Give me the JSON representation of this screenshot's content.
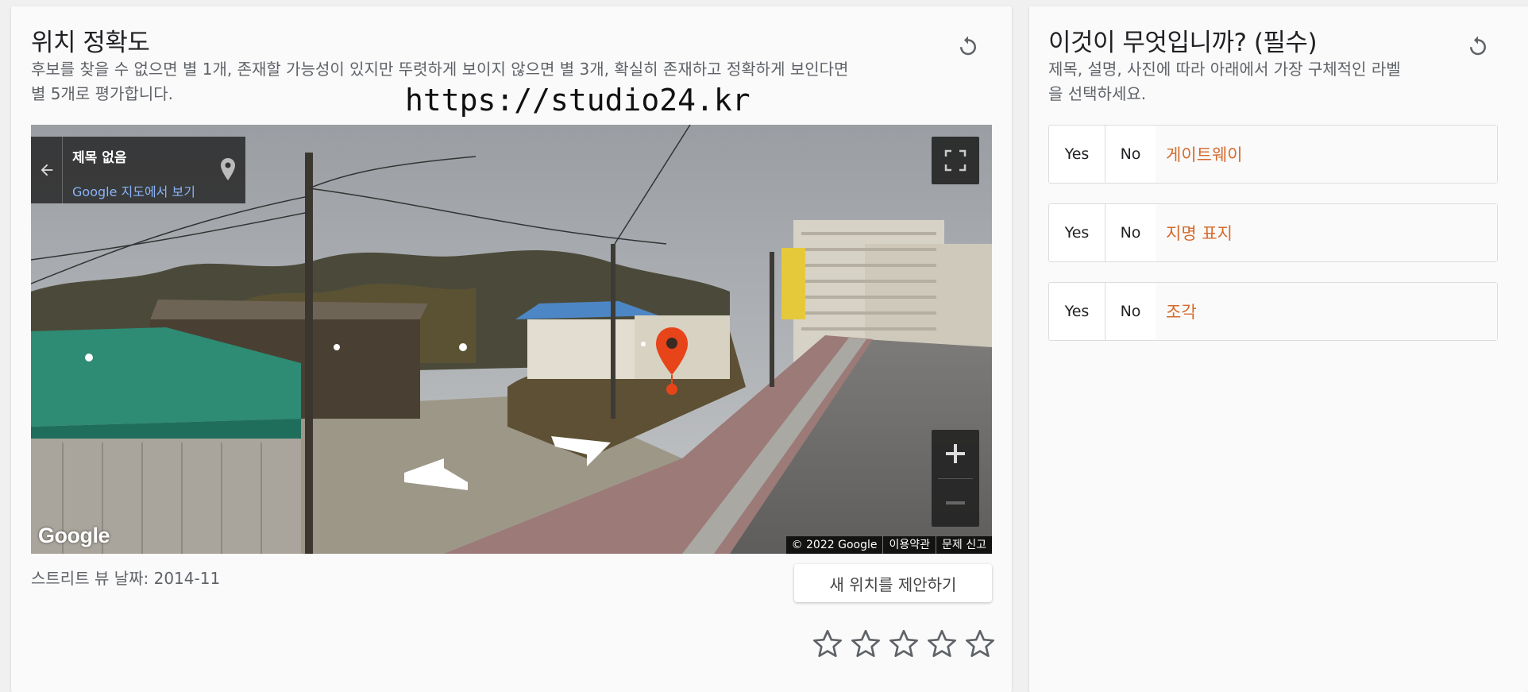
{
  "left": {
    "title": "위치 정확도",
    "description_line1": "후보를 찾을 수 없으면 별 1개, 존재할 가능성이 있지만 뚜렷하게 보이지 않으면 별 3개, 확실히 존재하고 정확하게 보인다면",
    "description_line2": "별 5개로 평가합니다.",
    "watermark": "https://studio24.kr",
    "streetview": {
      "place_title": "제목 없음",
      "maps_link": "Google 지도에서 보기",
      "logo": "Google",
      "copyright": "© 2022 Google",
      "terms": "이용약관",
      "report": "문제 신고"
    },
    "date_label": "스트리트 뷰 날짜: 2014-11",
    "suggest_button": "새 위치를 제안하기",
    "rating": {
      "max": 5,
      "value": 0
    }
  },
  "right": {
    "title": "이것이 무엇입니까? (필수)",
    "description_line1": "제목, 설명, 사진에 따라 아래에서 가장 구체적인 라벨",
    "description_line2": "을 선택하세요.",
    "options": [
      {
        "yes": "Yes",
        "no": "No",
        "label": "게이트웨이"
      },
      {
        "yes": "Yes",
        "no": "No",
        "label": "지명 표지"
      },
      {
        "yes": "Yes",
        "no": "No",
        "label": "조각"
      }
    ]
  },
  "colors": {
    "option_label": "#d56a2c",
    "map_pin": "#e8441a",
    "link": "#8ab4f8"
  }
}
